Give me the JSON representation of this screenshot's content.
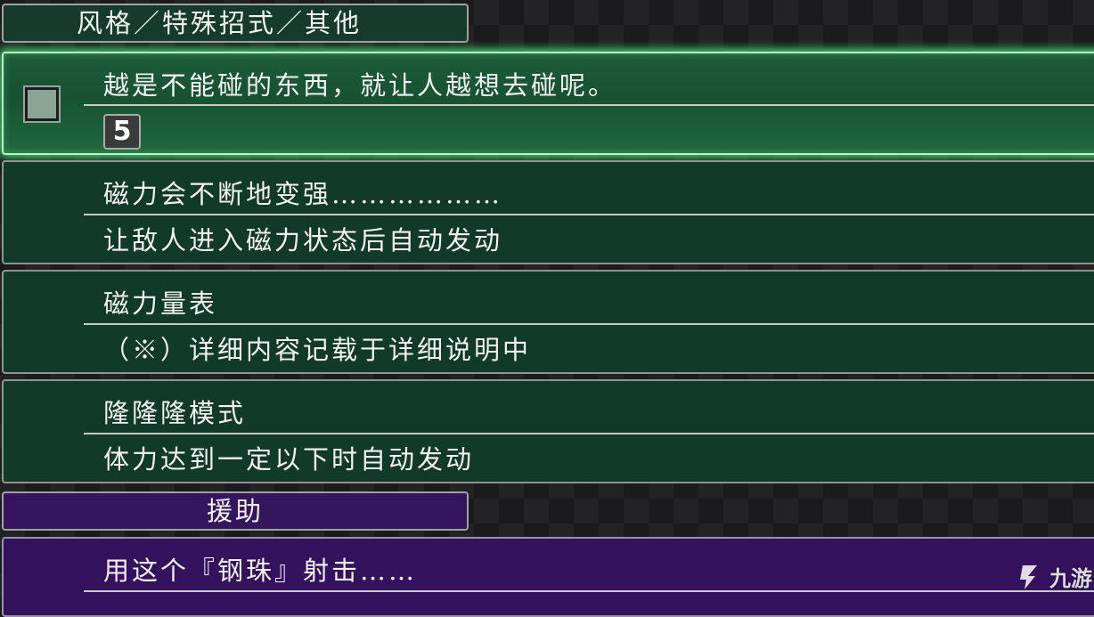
{
  "header": {
    "title": "风格／特殊招式／其他"
  },
  "skills": [
    {
      "title": "越是不能碰的东西，就让人越想去碰呢。",
      "cost": "5",
      "selected": true
    },
    {
      "title": "磁力会不断地变强………………",
      "desc": "让敌人进入磁力状态后自动发动"
    },
    {
      "title": "磁力量表",
      "desc": "（※）详细内容记载于详细说明中"
    },
    {
      "title": "隆隆隆模式",
      "desc": "体力达到一定以下时自动发动"
    }
  ],
  "assist": {
    "title": "援助",
    "skills": [
      {
        "title": "用这个『钢珠』射击……"
      }
    ]
  },
  "watermark": {
    "text": "九游"
  },
  "colors": {
    "green_panel": "#123a2a",
    "selected_glow": "#41d86e",
    "purple_panel": "#35125e"
  },
  "icons": {
    "checkbox": "square-checkbox",
    "watermark_logo": "jiuyou-logo-icon"
  }
}
